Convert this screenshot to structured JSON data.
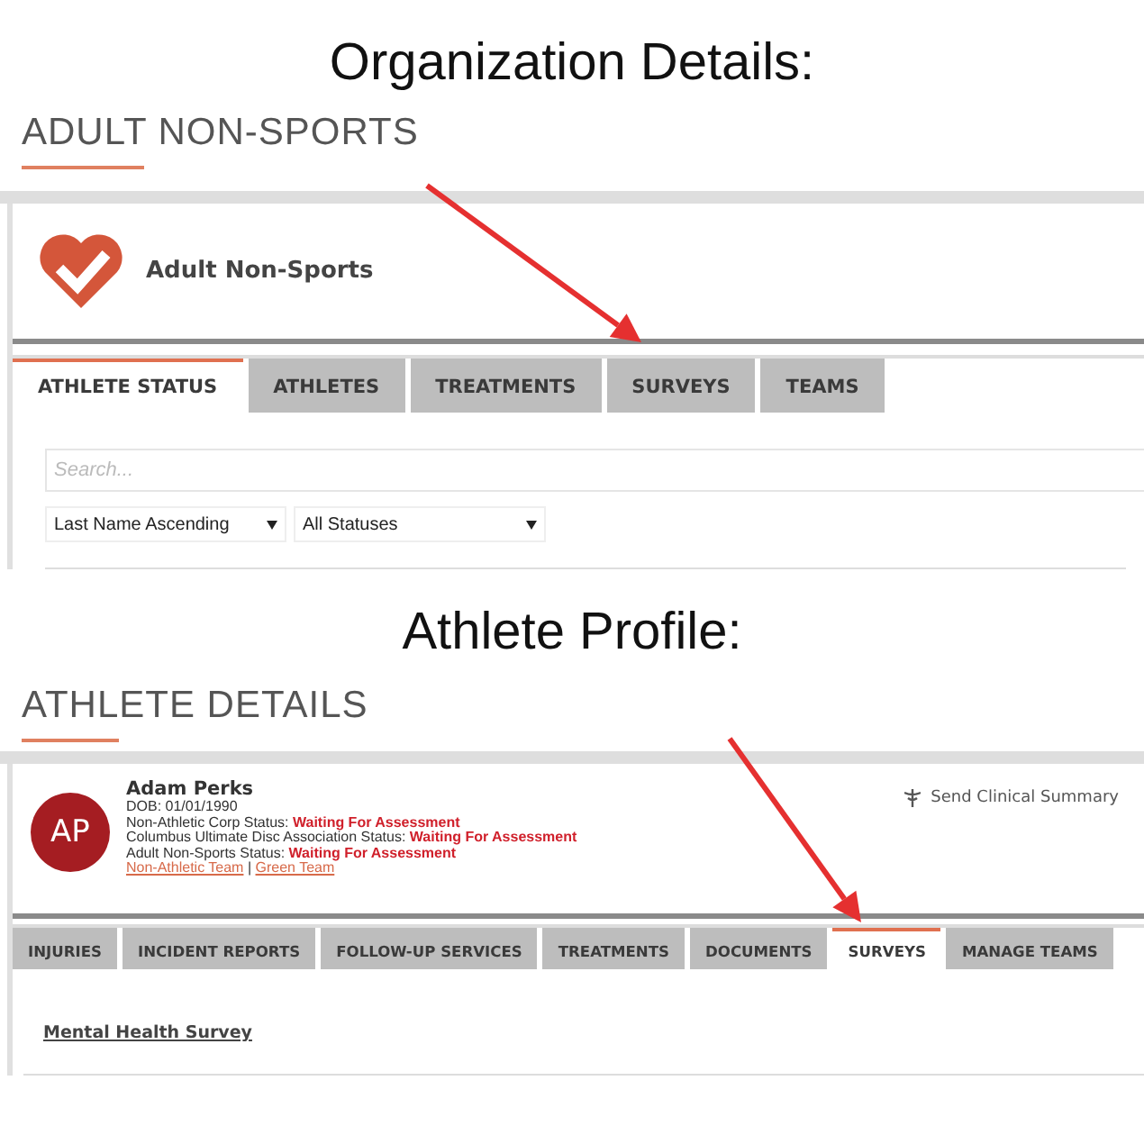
{
  "organization": {
    "caption": "Organization Details:",
    "heading": "ADULT NON-SPORTS",
    "name": "Adult Non-Sports",
    "tabs": [
      {
        "label": "ATHLETE STATUS",
        "selected": true
      },
      {
        "label": "ATHLETES",
        "selected": false
      },
      {
        "label": "TREATMENTS",
        "selected": false
      },
      {
        "label": "SURVEYS",
        "selected": false
      },
      {
        "label": "TEAMS",
        "selected": false
      }
    ],
    "search": {
      "placeholder": "Search..."
    },
    "selects": [
      {
        "value": "Last Name Ascending"
      },
      {
        "value": "All Statuses"
      }
    ]
  },
  "athlete": {
    "caption": "Athlete Profile:",
    "heading": "ATHLETE DETAILS",
    "initials": "AP",
    "name": "Adam Perks",
    "dob": "DOB: 01/01/1990",
    "statuses": [
      {
        "label": "Non-Athletic Corp Status:",
        "value": "Waiting For Assessment"
      },
      {
        "label": "Columbus Ultimate Disc Association Status:",
        "value": "Waiting For Assessment"
      },
      {
        "label": "Adult Non-Sports Status:",
        "value": "Waiting For Assessment"
      }
    ],
    "teams": [
      {
        "label": "Non-Athletic Team"
      },
      {
        "label": "Green Team"
      }
    ],
    "team_separator": "|",
    "action": "Send Clinical Summary",
    "tabs": [
      {
        "label": "INJURIES",
        "selected": false
      },
      {
        "label": "INCIDENT REPORTS",
        "selected": false
      },
      {
        "label": "FOLLOW-UP SERVICES",
        "selected": false
      },
      {
        "label": "TREATMENTS",
        "selected": false
      },
      {
        "label": "DOCUMENTS",
        "selected": false
      },
      {
        "label": "SURVEYS",
        "selected": true
      },
      {
        "label": "MANAGE TEAMS",
        "selected": false
      }
    ],
    "surveys": [
      {
        "label": "Mental Health Survey"
      }
    ]
  }
}
